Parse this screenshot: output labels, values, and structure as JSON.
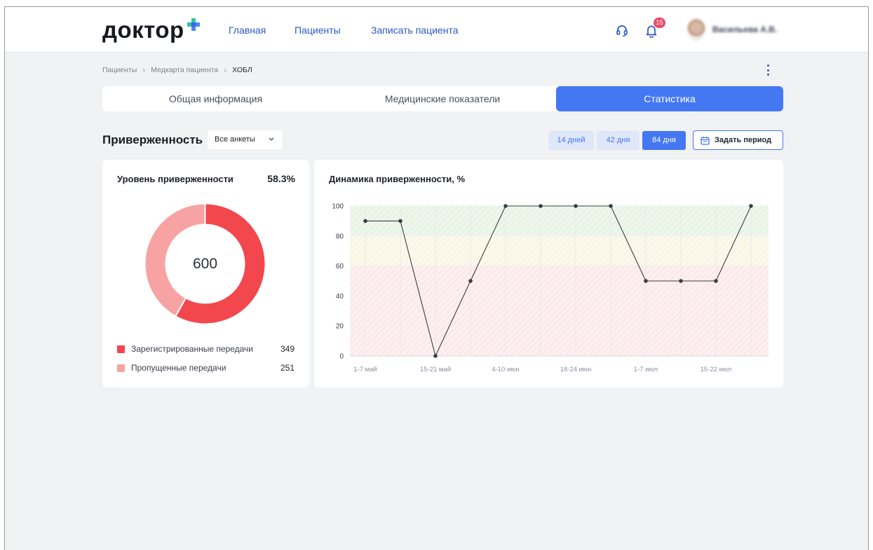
{
  "header": {
    "logo_text": "доктор",
    "nav": [
      {
        "label": "Главная"
      },
      {
        "label": "Пациенты"
      },
      {
        "label": "Записать пациента"
      }
    ],
    "notification_count": "15",
    "user_name": "Васильева А.В.",
    "icons": {
      "support": "headset-icon",
      "notifications": "bell-icon",
      "logo_mark": "plus-cross-icon"
    }
  },
  "breadcrumb": {
    "items": [
      "Пациенты",
      "Медкарта пациента",
      "ХОБЛ"
    ]
  },
  "tabs": [
    {
      "label": "Общая информация",
      "active": false
    },
    {
      "label": "Медицинские показатели",
      "active": false
    },
    {
      "label": "Статистика",
      "active": true
    }
  ],
  "toolbar": {
    "title": "Приверженность",
    "filter_value": "Все анкеты",
    "periods": [
      {
        "label": "14 дней",
        "active": false
      },
      {
        "label": "42 дня",
        "active": false
      },
      {
        "label": "84 дня",
        "active": true
      }
    ],
    "custom_period_label": "Задать период"
  },
  "level_card": {
    "title": "Уровень приверженности",
    "percent": "58.3%",
    "total": "600",
    "legend": [
      {
        "label": "Зарегистрированные передачи",
        "value": "349",
        "color": "#f2474d"
      },
      {
        "label": "Пропущенные передачи",
        "value": "251",
        "color": "#f7a3a3"
      }
    ]
  },
  "dynamics_card": {
    "title": "Динамика приверженности, %"
  },
  "colors": {
    "accent": "#4477f2",
    "zone_good": "#e6f3e4",
    "zone_warn": "#fbf4e2",
    "zone_bad": "#fbe7e7"
  },
  "chart_data": {
    "type": "line",
    "title": "Динамика приверженности, %",
    "xlabel": "",
    "ylabel": "",
    "ylim": [
      0,
      100
    ],
    "yticks": [
      0,
      20,
      40,
      60,
      80,
      100
    ],
    "x_tick_labels": [
      "1-7 май",
      "15-21 май",
      "4-10 июн",
      "18-24 июн",
      "1-7 июл",
      "15-22 июл"
    ],
    "grid": true,
    "zones": [
      {
        "from": 80,
        "to": 100,
        "level": "good"
      },
      {
        "from": 60,
        "to": 80,
        "level": "warn"
      },
      {
        "from": 0,
        "to": 60,
        "level": "bad"
      }
    ],
    "series": [
      {
        "values": [
          90,
          90,
          0,
          50,
          100,
          100,
          100,
          100,
          50,
          50,
          50,
          100
        ]
      }
    ]
  }
}
